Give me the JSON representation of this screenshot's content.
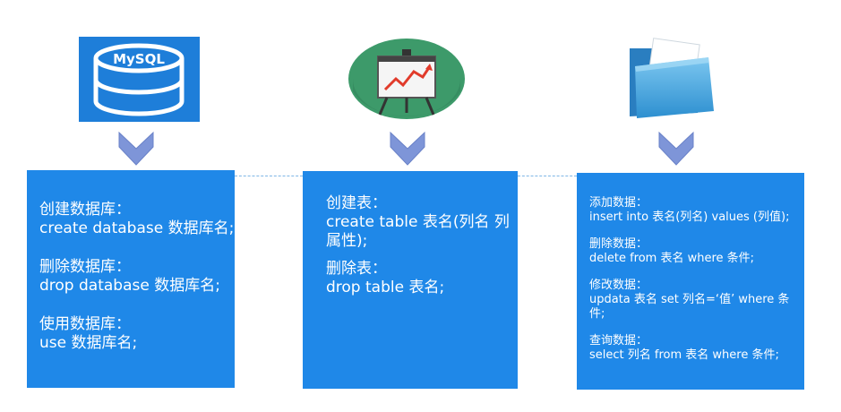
{
  "colors": {
    "box": "#1f88e8",
    "arrow": "#7e95d8",
    "mysql_bg": "#1e7ed9"
  },
  "mysql_logo": {
    "text": "MySQL"
  },
  "boxes": [
    {
      "sections": [
        {
          "title": "创建数据库：",
          "code": "create database 数据库名;"
        },
        {
          "title": "删除数据库：",
          "code": "drop database 数据库名;"
        },
        {
          "title": "使用数据库：",
          "code": "use 数据库名;"
        }
      ]
    },
    {
      "sections": [
        {
          "title": "创建表：",
          "code": "create table 表名(列名 列属性);"
        },
        {
          "title": "删除表：",
          "code": "drop table 表名;"
        }
      ]
    },
    {
      "sections": [
        {
          "title": "添加数据：",
          "code": "insert into 表名(列名) values (列值);"
        },
        {
          "title": "删除数据：",
          "code": "delete from 表名 where 条件;"
        },
        {
          "title": "修改数据：",
          "code": "updata 表名 set 列名=‘值’ where 条件;"
        },
        {
          "title": "查询数据：",
          "code": "select 列名 from 表名 where 条件;"
        }
      ]
    }
  ]
}
